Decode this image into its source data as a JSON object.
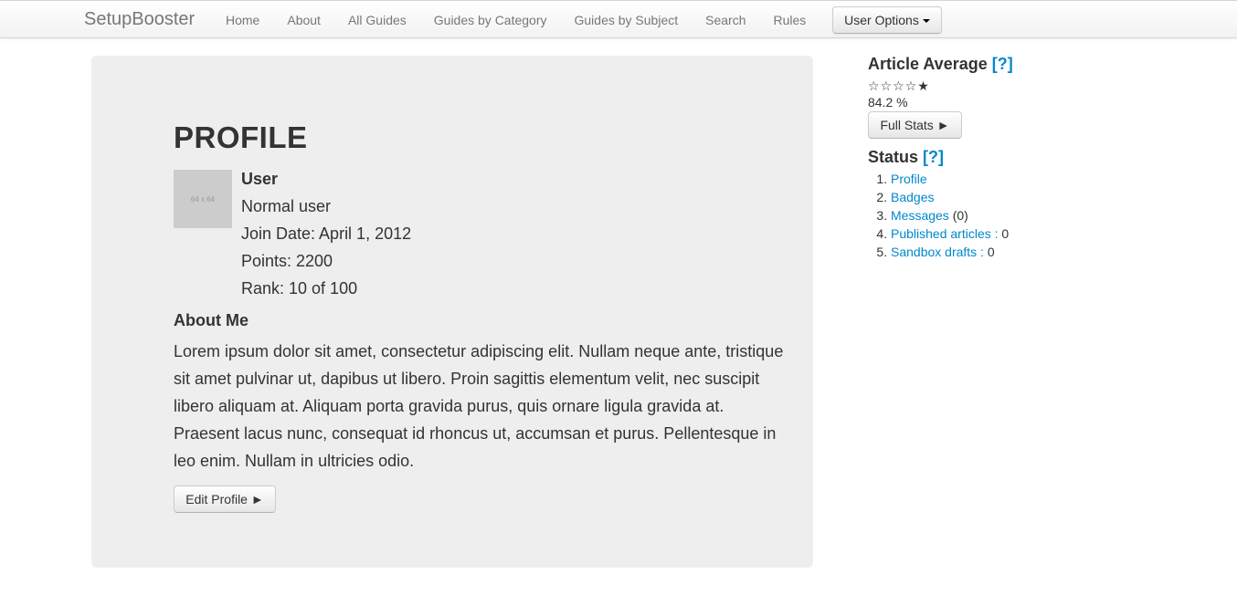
{
  "navbar": {
    "brand": "SetupBooster",
    "links": [
      "Home",
      "About",
      "All Guides",
      "Guides by Category",
      "Guides by Subject",
      "Search",
      "Rules"
    ],
    "user_options_label": "User Options"
  },
  "profile": {
    "title": "PROFILE",
    "avatar_placeholder": "64 x 64",
    "username": "User",
    "role": "Normal user",
    "join_date": "Join Date: April 1, 2012",
    "points": "Points: 2200",
    "rank": "Rank: 10 of 100",
    "about_heading": "About Me",
    "about_text": "Lorem ipsum dolor sit amet, consectetur adipiscing elit. Nullam neque ante, tristique sit amet pulvinar ut, dapibus ut libero. Proin sagittis elementum velit, nec suscipit libero aliquam at. Aliquam porta gravida purus, quis ornare ligula gravida at. Praesent lacus nunc, consequat id rhoncus ut, accumsan et purus. Pellentesque in leo enim. Nullam in ultricies odio.",
    "edit_button": "Edit Profile ►"
  },
  "sidebar": {
    "article_average": {
      "heading": "Article Average",
      "help": "[?]",
      "stars": "☆☆☆☆★",
      "percent": "84.2 %",
      "full_stats_button": "Full Stats ►"
    },
    "status": {
      "heading": "Status",
      "help": "[?]",
      "items": [
        {
          "link": "Profile",
          "suffix": ""
        },
        {
          "link": "Badges",
          "suffix": ""
        },
        {
          "link": "Messages",
          "suffix": " (0)"
        },
        {
          "link": "Published articles :",
          "suffix": " 0"
        },
        {
          "link": "Sandbox drafts :",
          "suffix": " 0"
        }
      ]
    }
  },
  "colors": {
    "link": "#0088cc",
    "well_background": "#eeeeee",
    "text": "#333333",
    "nav_text": "#777777"
  }
}
